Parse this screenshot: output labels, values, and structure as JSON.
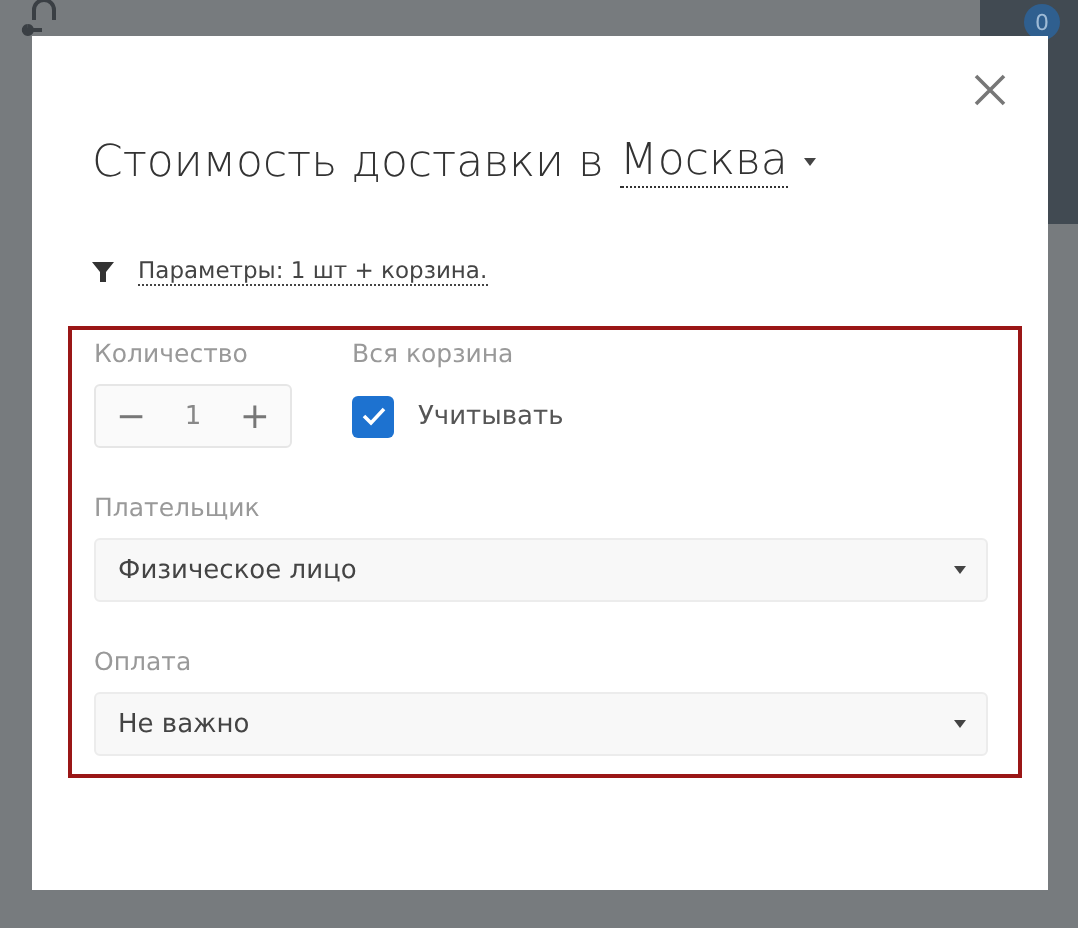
{
  "background": {
    "badge": "0"
  },
  "dialog": {
    "title": "Стоимость доставки в",
    "city": "Москва",
    "params_link": "Параметры: 1 шт + корзина.",
    "quantity": {
      "label": "Количество",
      "value": "1",
      "minus": "−",
      "plus": "+"
    },
    "whole_cart": {
      "label": "Вся корзина",
      "checkbox_label": "Учитывать",
      "checked": true
    },
    "selects": [
      {
        "label": "Плательщик",
        "value": "Физическое лицо"
      },
      {
        "label": "Оплата",
        "value": "Не важно"
      }
    ]
  }
}
